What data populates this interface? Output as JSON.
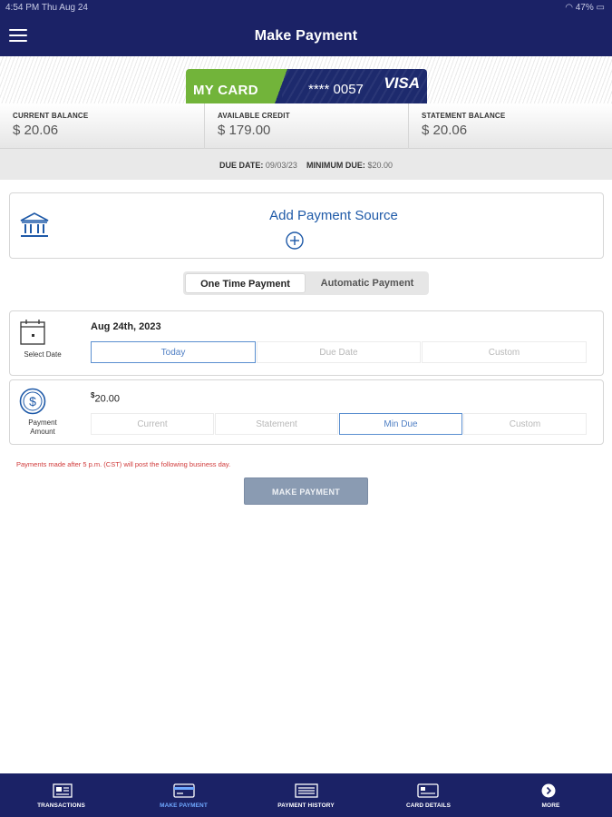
{
  "status": {
    "time": "4:54 PM  Thu Aug 24",
    "battery": "47%"
  },
  "header": {
    "title": "Make Payment"
  },
  "card": {
    "name": "MY CARD",
    "number": "**** 0057",
    "brand": "VISA"
  },
  "balances": [
    {
      "label": "CURRENT BALANCE",
      "value": "$ 20.06"
    },
    {
      "label": "AVAILABLE CREDIT",
      "value": "$ 179.00"
    },
    {
      "label": "STATEMENT BALANCE",
      "value": "$ 20.06"
    }
  ],
  "due": {
    "date_label": "DUE DATE:",
    "date": "09/03/23",
    "min_label": "MINIMUM DUE:",
    "min": "$20.00"
  },
  "add_source": {
    "label": "Add Payment Source"
  },
  "payment_type": {
    "one_time": "One Time Payment",
    "automatic": "Automatic Payment"
  },
  "date_row": {
    "label": "Select Date",
    "value": "Aug 24th, 2023",
    "options": [
      "Today",
      "Due Date",
      "Custom"
    ],
    "selected": "Today"
  },
  "amount_row": {
    "label": "Payment Amount",
    "currency_symbol": "$",
    "value": "20.00",
    "options": [
      "Current",
      "Statement",
      "Min Due",
      "Custom"
    ],
    "selected": "Min Due"
  },
  "notice": "Payments made after 5 p.m. (CST) will post the following business day.",
  "make_payment_button": "MAKE PAYMENT",
  "nav": [
    {
      "label": "TRANSACTIONS",
      "icon": "transactions-icon"
    },
    {
      "label": "MAKE PAYMENT",
      "icon": "card-payment-icon",
      "active": true
    },
    {
      "label": "PAYMENT HISTORY",
      "icon": "payment-history-icon"
    },
    {
      "label": "CARD DETAILS",
      "icon": "card-details-icon"
    },
    {
      "label": "MORE",
      "icon": "chevron-right-circle-icon"
    }
  ],
  "colors": {
    "header": "#1b2266",
    "accent": "#1f5aa8",
    "card_green": "#72b43a",
    "warning": "#d03a3a"
  }
}
